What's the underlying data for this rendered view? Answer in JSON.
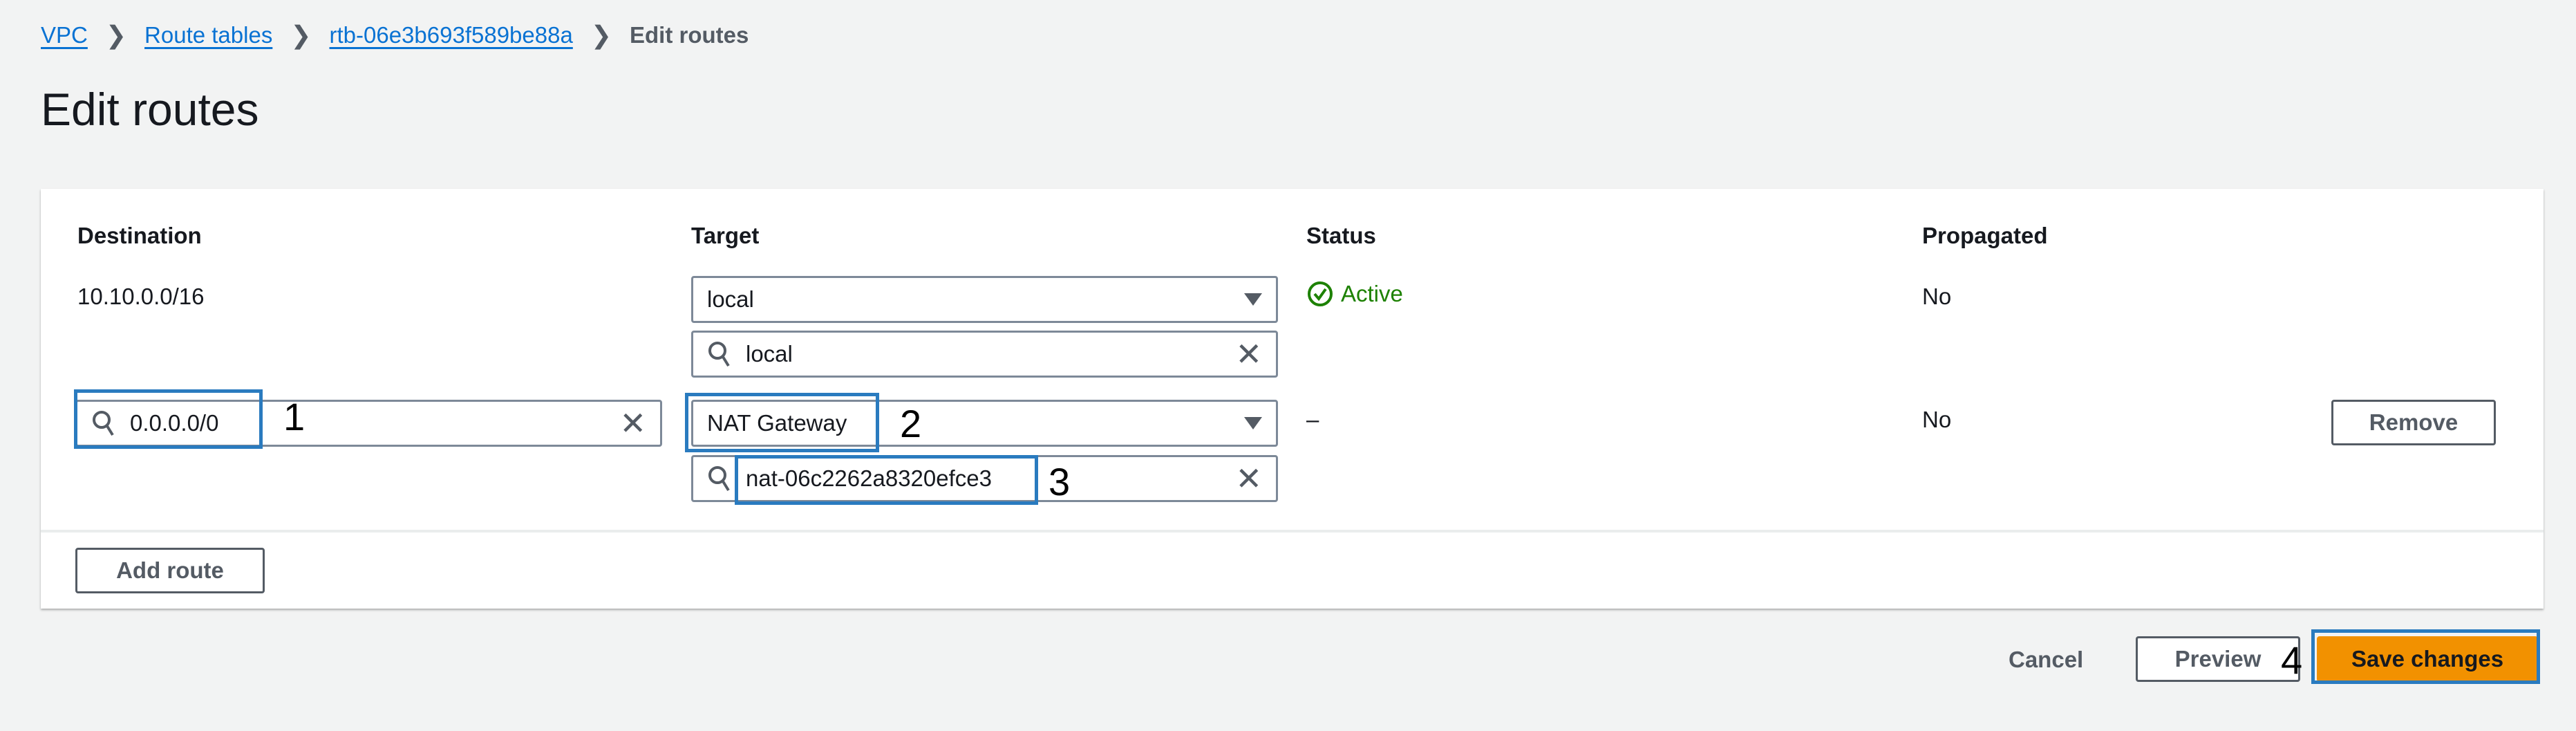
{
  "breadcrumb": [
    {
      "label": "VPC"
    },
    {
      "label": "Route tables"
    },
    {
      "label": "rtb-06e3b693f589be88a"
    }
  ],
  "breadcrumb_current": "Edit routes",
  "page_title": "Edit routes",
  "columns": {
    "destination": "Destination",
    "target": "Target",
    "status": "Status",
    "propagated": "Propagated"
  },
  "routes": [
    {
      "destination": "10.10.0.0/16",
      "target": "local",
      "target_search": "local",
      "status": "Active",
      "propagated": "No"
    },
    {
      "destination": "0.0.0.0/0",
      "target": "NAT Gateway",
      "target_search": "nat-06c2262a8320efce3",
      "status": "–",
      "propagated": "No",
      "remove_label": "Remove"
    }
  ],
  "add_route_label": "Add route",
  "footer": {
    "cancel": "Cancel",
    "preview": "Preview",
    "save": "Save changes"
  },
  "annotations": [
    "1",
    "2",
    "3",
    "4"
  ],
  "colors": {
    "accent": "#ff9900",
    "link": "#0972d3",
    "success": "#1d8102",
    "annotation": "#2a7bbf"
  }
}
